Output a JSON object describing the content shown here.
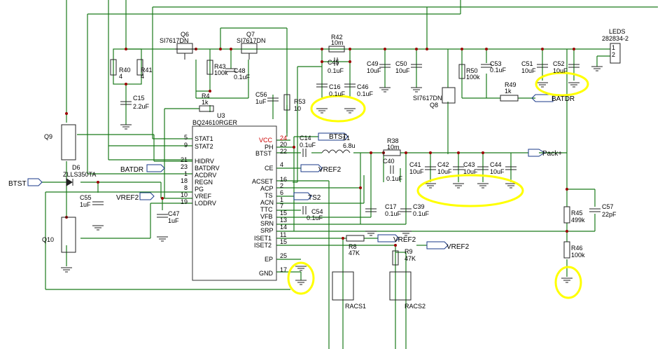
{
  "ic": {
    "ref": "U3",
    "part": "BQ24610RGER",
    "left_pins": [
      {
        "name": "STAT1",
        "num": "5"
      },
      {
        "name": "STAT2",
        "num": "9"
      },
      {
        "name": "HIDRV",
        "num": "21"
      },
      {
        "name": "BATDRV",
        "num": "23"
      },
      {
        "name": "ACDRV",
        "num": "1"
      },
      {
        "name": "REGN",
        "num": "18"
      },
      {
        "name": "PG",
        "num": "8"
      },
      {
        "name": "VREF",
        "num": "10"
      },
      {
        "name": "LODRV",
        "num": "19"
      }
    ],
    "right_pins": [
      {
        "name": "VCC",
        "num": "24"
      },
      {
        "name": "PH",
        "num": "20"
      },
      {
        "name": "BTST",
        "num": "22"
      },
      {
        "name": "CE",
        "num": "4"
      },
      {
        "name": "ACSET",
        "num": "16"
      },
      {
        "name": "ACP",
        "num": "2"
      },
      {
        "name": "TS",
        "num": "6"
      },
      {
        "name": "ACN",
        "num": "1"
      },
      {
        "name": "TTC",
        "num": "7"
      },
      {
        "name": "VFB",
        "num": "15"
      },
      {
        "name": "SRN",
        "num": "13"
      },
      {
        "name": "SRP",
        "num": "14"
      },
      {
        "name": "ISET1",
        "num": "11"
      },
      {
        "name": "ISET2",
        "num": "15"
      },
      {
        "name": "EP",
        "num": "25"
      },
      {
        "name": "GND",
        "num": "17"
      }
    ]
  },
  "labels": {
    "q6": "Q6",
    "q6p": "SI7617DN",
    "q7": "Q7",
    "q7p": "SI7617DN",
    "q8": "Q8",
    "q8p": "SI7617DN",
    "q9": "Q9",
    "q10": "Q10",
    "d6": "D6",
    "d6p": "ZLLS350TA",
    "r40": "R40",
    "r40v": "4",
    "r41": "R41",
    "r41v": "4",
    "c15": "C15",
    "c15v": "2.2uF",
    "r43": "R43",
    "r43v": "100k",
    "c48": "C48",
    "c48v": "0.1uF",
    "r44": "R4",
    "r44v": "1k",
    "r42": "R42",
    "r42v": "10m",
    "c45": "C45",
    "c45v": "0.1uF",
    "c16": "C16",
    "c16v": "0.1uF",
    "c46": "C46",
    "c46v": "0.1uF",
    "c49": "C49",
    "c49v": "10uF",
    "c50": "C50",
    "c50v": "10uF",
    "c56": "C56",
    "c56v": "1uF",
    "r53": "R53",
    "r53v": "10",
    "r50": "R50",
    "r50v": "100k",
    "c53": "C53",
    "c53v": "0.1uF",
    "r49": "R49",
    "r49v": "1k",
    "c51": "C51",
    "c51v": "10uF",
    "c52": "C52",
    "c52v": "10uF",
    "leds": "LEDS",
    "ledsp": "282834-2",
    "led1": "1",
    "led2": "2",
    "c14": "C14",
    "c14v": "0.1uF",
    "l1": "L1",
    "l1v": "6.8u",
    "r38": "R38",
    "r38v": "10m",
    "c40": "C40",
    "c40v": "0.1uF",
    "c41": "C41",
    "c41v": "10uF",
    "c42": "C42",
    "c42v": "10uF",
    "c43": "C43",
    "c43v": "10uF",
    "c44": "C44",
    "c44v": "10uF",
    "c17": "C17",
    "c17v": "0.1uF",
    "c39": "C39",
    "c39v": "0.1uF",
    "c54": "C54",
    "c54v": "0.1uF",
    "c55": "C55",
    "c55v": "1uF",
    "c47": "C47",
    "c47v": "1uF",
    "r8": "R8",
    "r8v": "47K",
    "r9": "R9",
    "r9v": "47K",
    "racs1": "RACS1",
    "racs2": "RACS2",
    "r45": "R45",
    "r45v": "499k",
    "r46": "R46",
    "r46v": "100k",
    "c57": "C57",
    "c57v": "22pF"
  },
  "nets": {
    "btst_top": "BTST",
    "batdr_right": "BATDR",
    "pack": "Pack+",
    "vref2_ce": "VREF2",
    "ts2": "TS2",
    "vref2_iset1": "VREF2",
    "vref2_r9": "VREF2",
    "batdr_left": "BATDR",
    "btst_left": "BTST",
    "vref2_left": "VREF2"
  },
  "colors": {
    "wire": "#1a7a1a",
    "part": "#7a1a1a",
    "highlight": "#ffff00"
  }
}
